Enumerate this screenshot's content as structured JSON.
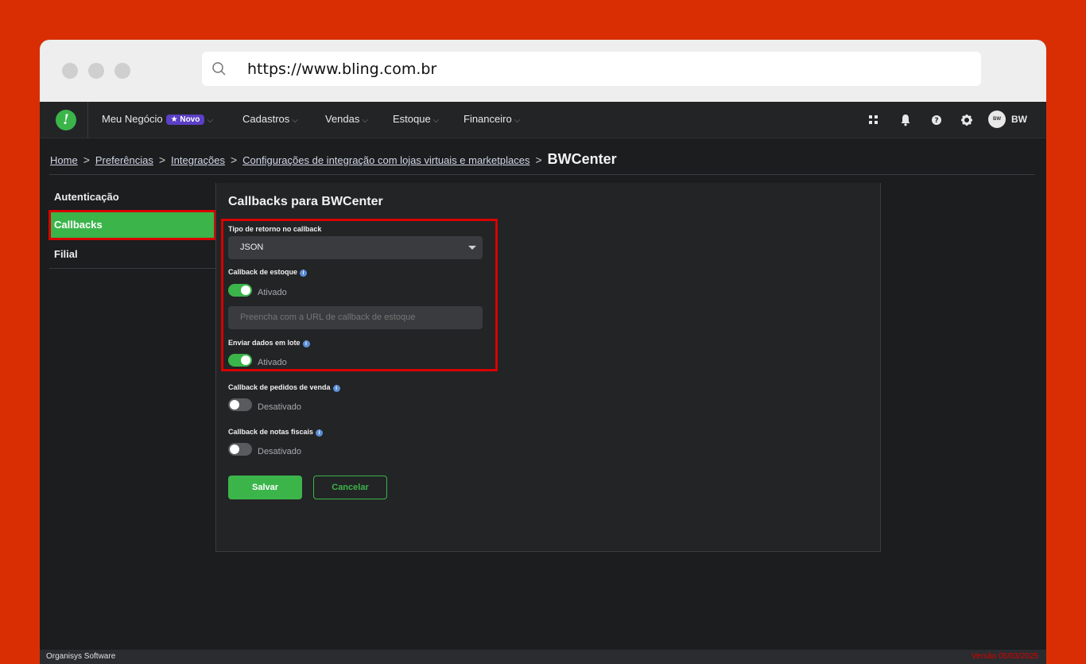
{
  "browser": {
    "url": "https://www.bling.com.br"
  },
  "navbar": {
    "logo": "!",
    "items": [
      {
        "label": "Meu Negócio",
        "badge": "★ Novo"
      },
      {
        "label": "Cadastros"
      },
      {
        "label": "Vendas"
      },
      {
        "label": "Estoque"
      },
      {
        "label": "Financeiro"
      }
    ],
    "user": "BW",
    "avatar_text": "BW"
  },
  "breadcrumb": {
    "links": [
      "Home",
      "Preferências",
      "Integrações",
      "Configurações de integração com lojas virtuais e marketplaces"
    ],
    "current": "BWCenter"
  },
  "sidebar": {
    "items": [
      {
        "label": "Autenticação"
      },
      {
        "label": "Callbacks"
      },
      {
        "label": "Filial"
      }
    ]
  },
  "panel": {
    "title": "Callbacks para BWCenter",
    "return_type": {
      "label": "Tipo de retorno no callback",
      "value": "JSON"
    },
    "stock_callback": {
      "label": "Callback de estoque",
      "status": "Ativado",
      "placeholder": "Preencha com a URL de callback de estoque"
    },
    "batch": {
      "label": "Enviar dados em lote",
      "status": "Ativado"
    },
    "orders_callback": {
      "label": "Callback de pedidos de venda",
      "status": "Desativado"
    },
    "invoices_callback": {
      "label": "Callback de notas fiscais",
      "status": "Desativado"
    },
    "save_label": "Salvar",
    "cancel_label": "Cancelar"
  },
  "footer": {
    "left": "Organisys Software",
    "right": "Versão 05/03/2025"
  },
  "colors": {
    "accent": "#3bb54a",
    "highlight": "#d80000",
    "background": "#d92e04"
  }
}
